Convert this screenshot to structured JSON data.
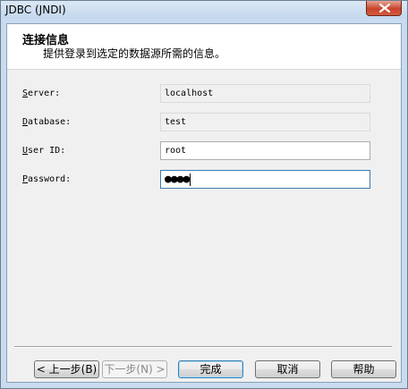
{
  "window": {
    "title": "JDBC (JNDI)"
  },
  "header": {
    "title": "连接信息",
    "description": "提供登录到选定的数据源所需的信息。"
  },
  "fields": {
    "server": {
      "label_mnemonic": "S",
      "label_rest": "erver:",
      "value": "localhost"
    },
    "database": {
      "label_mnemonic": "D",
      "label_rest": "atabase:",
      "value": "test"
    },
    "user_id": {
      "label_mnemonic": "U",
      "label_rest": "ser ID:",
      "value": "root"
    },
    "password": {
      "label_mnemonic": "P",
      "label_rest": "assword:",
      "value": "●●●●"
    }
  },
  "buttons": {
    "back": "< 上一步(B)",
    "next": "下一步(N) >",
    "finish": "完成",
    "cancel": "取消",
    "help": "帮助"
  }
}
